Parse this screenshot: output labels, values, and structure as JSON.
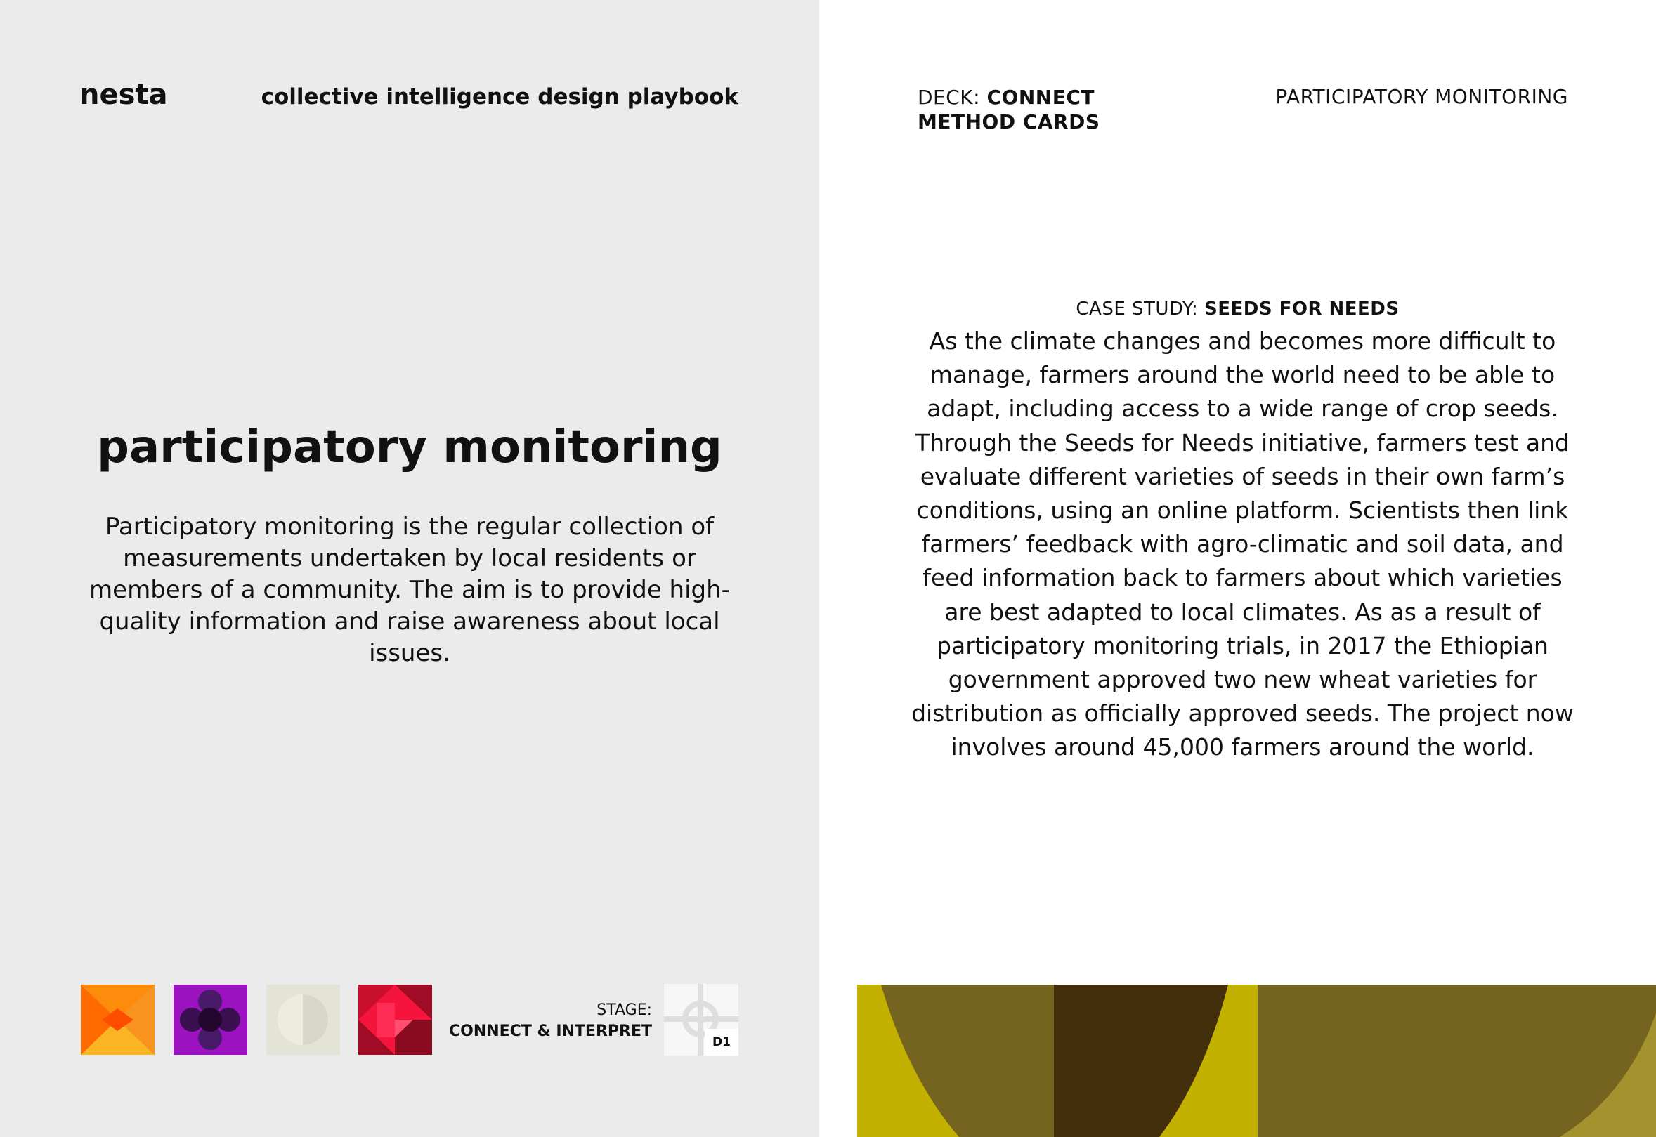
{
  "left_card": {
    "logo": "nesta",
    "playbook_title": "collective intelligence design playbook",
    "method_title": "participatory monitoring",
    "description": "Participatory monitoring is the regular collection of measurements undertaken by local residents or members of a community. The aim is to provide high-quality information and raise awareness about local issues.",
    "stage_label": "STAGE:",
    "stage_value": "CONNECT & INTERPRET",
    "card_code": "D1",
    "icons": [
      "orange-bowtie-icon",
      "purple-circles-icon",
      "pale-half-circle-icon",
      "red-triangles-icon",
      "crosshair-icon"
    ]
  },
  "right_card": {
    "deck_label": "DECK:",
    "deck_name_line1": "CONNECT",
    "deck_name_line2": "METHOD CARDS",
    "method_label": "PARTICIPATORY MONITORING",
    "case_label": "CASE STUDY:",
    "case_name": "SEEDS FOR NEEDS",
    "case_text": "As the climate changes and becomes more difficult to manage, farmers around the world need to be able to adapt, including access to a wide range of crop seeds. Through the Seeds for Needs initiative, farmers test and evaluate different varieties of seeds in their own farm’s conditions, using an online platform. Scientists then link farmers’ feedback with agro-climatic and soil data, and feed information back to farmers about which varieties are best adapted to local climates. As as a result of participatory monitoring trials, in 2017 the Ethiopian government approved two new wheat varieties for distribution as officially approved seeds. The project now involves around 45,000 farmers around the world."
  },
  "colors": {
    "left_background": "#ebebeb",
    "banner_olive": "#75641f",
    "banner_yellow": "#c2b100",
    "banner_dark": "#432f0b"
  }
}
